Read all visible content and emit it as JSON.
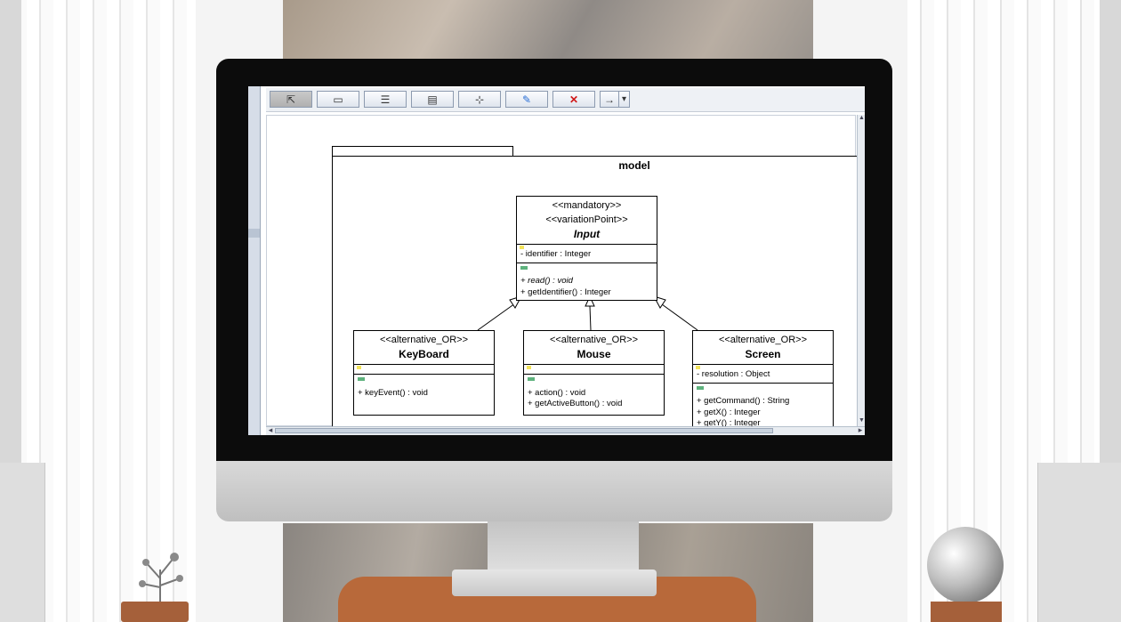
{
  "toolbar": {
    "buttons": [
      {
        "name": "select-tool",
        "icon": "cursor-arrow-icon",
        "glyph": "⇱"
      },
      {
        "name": "package-tool",
        "icon": "folder-icon",
        "glyph": "▭"
      },
      {
        "name": "class-tool",
        "icon": "class-icon",
        "glyph": "☰"
      },
      {
        "name": "interface-tool",
        "icon": "interface-icon",
        "glyph": "▤"
      },
      {
        "name": "association-tool",
        "icon": "association-icon",
        "glyph": "⊹"
      },
      {
        "name": "note-tool",
        "icon": "note-edit-icon",
        "glyph": "✎"
      },
      {
        "name": "delete-tool",
        "icon": "delete-x-icon",
        "glyph": "✕"
      },
      {
        "name": "relation-dropdown",
        "icon": "arrow-relation-icon",
        "glyph": "→"
      }
    ],
    "dropdown_glyph": "▾"
  },
  "package": {
    "name": "model"
  },
  "classes": {
    "input": {
      "stereotype1": "<<mandatory>>",
      "stereotype2": "<<variationPoint>>",
      "name": "Input",
      "attributes": [
        "- identifier : Integer"
      ],
      "operations": [
        "+ read() : void",
        "+ getIdentifier() : Integer"
      ]
    },
    "keyboard": {
      "stereotype": "<<alternative_OR>>",
      "name": "KeyBoard",
      "attributes": [],
      "operations": [
        "+ keyEvent() : void"
      ]
    },
    "mouse": {
      "stereotype": "<<alternative_OR>>",
      "name": "Mouse",
      "attributes": [],
      "operations": [
        "+ action() : void",
        "+ getActiveButton() : void"
      ]
    },
    "screen": {
      "stereotype": "<<alternative_OR>>",
      "name": "Screen",
      "attributes": [
        "- resolution : Object"
      ],
      "operations": [
        "+ getCommand() : String",
        "+ getX() : Integer",
        "+ getY() : Integer"
      ]
    }
  },
  "scroll": {
    "vertical_up": "▲",
    "vertical_down": "▼",
    "horizontal_left": "◂",
    "horizontal_right": "▸"
  }
}
